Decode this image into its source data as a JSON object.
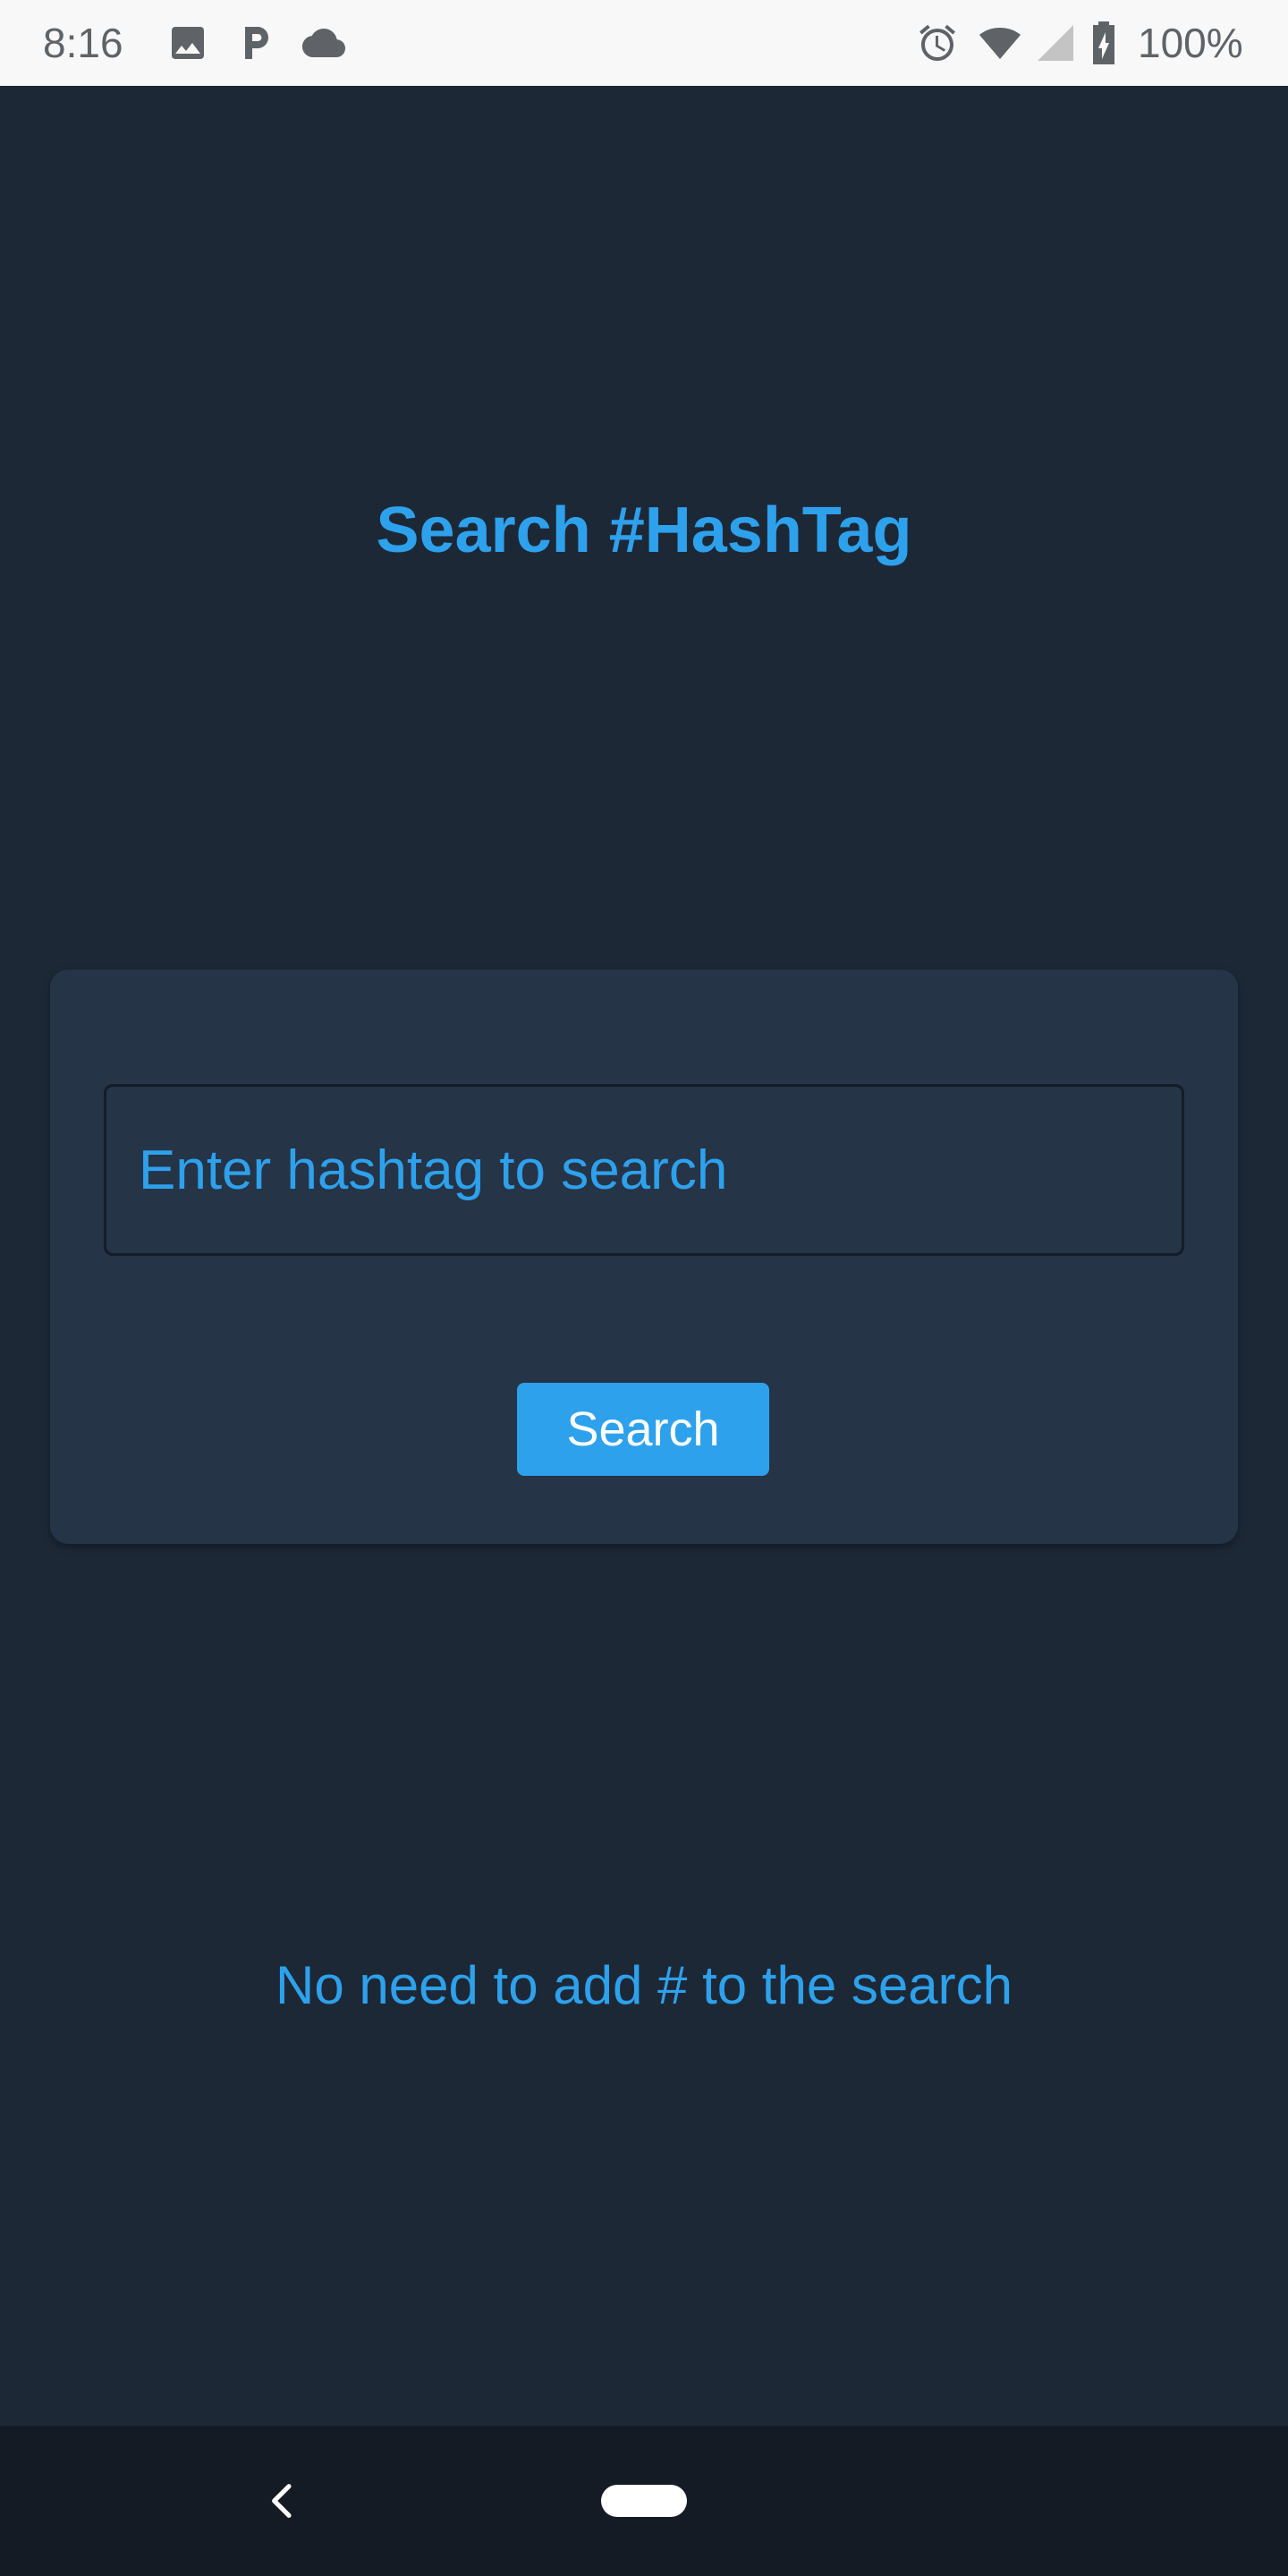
{
  "status_bar": {
    "time": "8:16",
    "battery_percent": "100%",
    "icons": [
      "image-icon",
      "parking-icon",
      "cloud-icon",
      "alarm-icon",
      "wifi-icon",
      "cell-signal-icon",
      "battery-charging-icon"
    ]
  },
  "main": {
    "title": "Search #HashTag",
    "search_placeholder": "Enter hashtag to search",
    "search_button_label": "Search",
    "hint": "No need to add # to the search"
  },
  "nav_bar": {
    "icons": [
      "back-icon",
      "home-pill-icon"
    ]
  },
  "colors": {
    "background": "#1d2837",
    "card": "#253447",
    "accent": "#2ea1ec",
    "nav_bar": "#141b24",
    "status_bar": "#f8f8f8"
  }
}
